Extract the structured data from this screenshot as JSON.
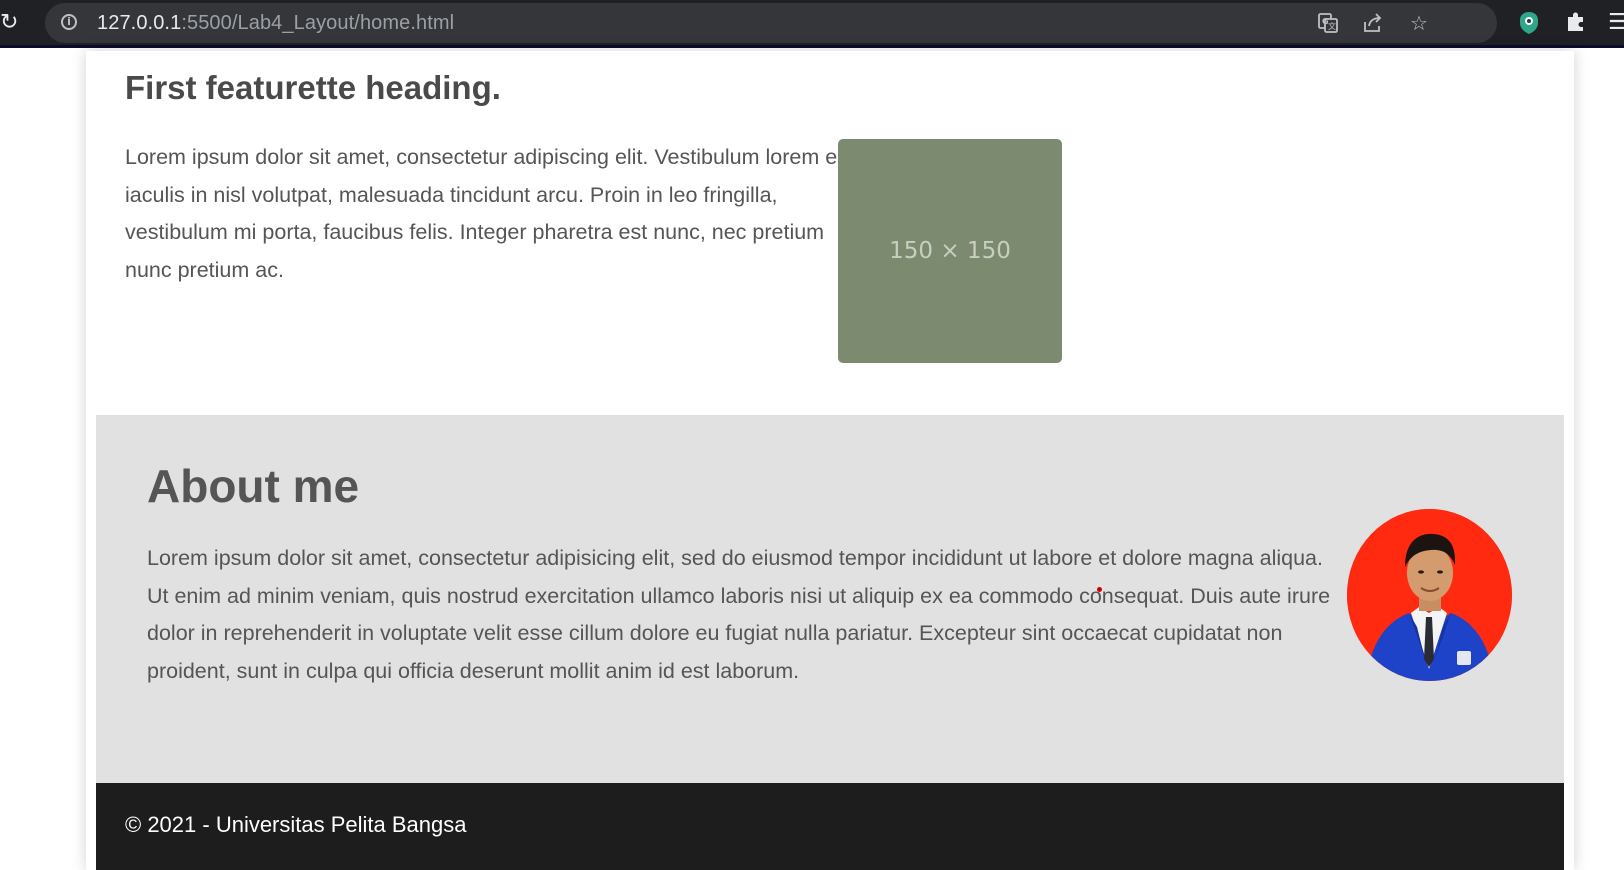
{
  "browser": {
    "url_host": "127.0.0.1",
    "url_rest": ":5500/Lab4_Layout/home.html",
    "icons": [
      "reload-icon",
      "info-icon",
      "translate-icon",
      "share-icon",
      "bookmark-star-icon",
      "extension-eye-icon",
      "extensions-puzzle-icon",
      "menu-icon"
    ]
  },
  "featurette": {
    "heading": "First featurette heading.",
    "text": "Lorem ipsum dolor sit amet, consectetur adipiscing elit. Vestibulum lorem elit, iaculis in nisl volutpat, malesuada tincidunt arcu. Proin in leo fringilla, vestibulum mi porta, faucibus felis. Integer pharetra est nunc, nec pretium nunc pretium ac.",
    "image_label": "150 × 150",
    "image_color": "#7c8a6f"
  },
  "about": {
    "heading": "About me",
    "text": "Lorem ipsum dolor sit amet, consectetur adipisicing elit, sed do eiusmod tempor incididunt ut labore et dolore magna aliqua. Ut enim ad minim veniam, quis nostrud exercitation ullamco laboris nisi ut aliquip ex ea commodo consequat. Duis aute irure dolor in reprehenderit in voluptate velit esse cillum dolore eu fugiat nulla pariatur. Excepteur sint occaecat cupidatat non proident, sunt in culpa qui officia deserunt mollit anim id est laborum.",
    "background": "#e1e1e1",
    "avatar_background": "#ff2a0f"
  },
  "footer": {
    "text": "© 2021 - Universitas Pelita Bangsa",
    "background": "#1d1d1d"
  }
}
